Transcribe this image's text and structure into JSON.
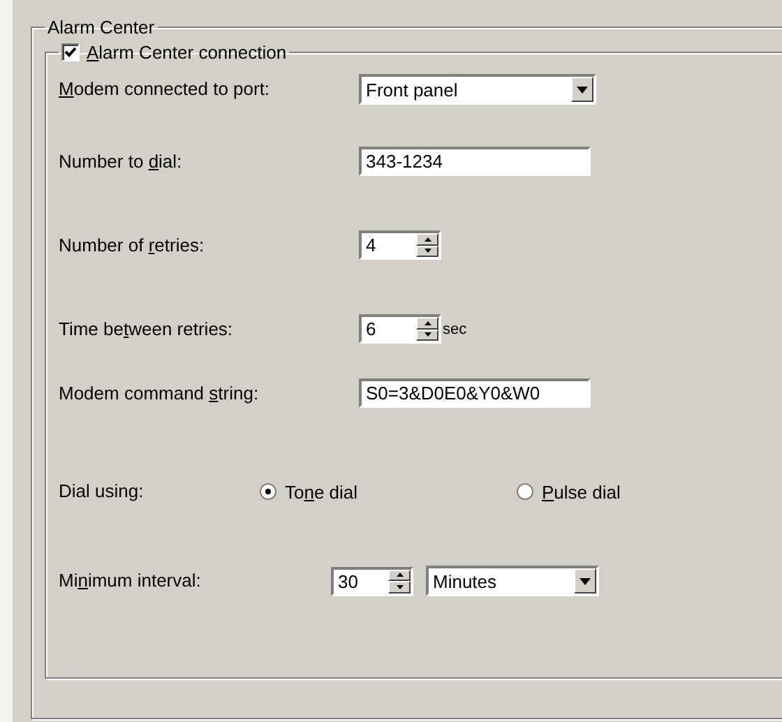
{
  "group": {
    "title": "Alarm Center"
  },
  "connection": {
    "label": {
      "key": "A",
      "post": "larm Center connection"
    },
    "checked": true
  },
  "rows": [
    {
      "kind": "combo",
      "label": {
        "key": "M",
        "post": "odem connected to port:"
      },
      "value": "Front panel"
    },
    {
      "kind": "text",
      "label": {
        "pre": "Number to ",
        "key": "d",
        "post": "ial:"
      },
      "value": "343-1234"
    },
    {
      "kind": "spin",
      "label": {
        "pre": "Number of ",
        "key": "r",
        "post": "etries:"
      },
      "value": "4"
    },
    {
      "kind": "spin",
      "label": {
        "pre": "Time be",
        "key": "t",
        "post": "ween retries:"
      },
      "value": "6",
      "unit": "sec"
    },
    {
      "kind": "text",
      "label": {
        "pre": "Modem command ",
        "key": "s",
        "post": "tring:"
      },
      "value": "S0=3&D0E0&Y0&W0"
    },
    {
      "kind": "radios",
      "label": {
        "pre": "Dial using:"
      },
      "options": [
        {
          "label": {
            "pre": "To",
            "key": "n",
            "post": "e dial"
          },
          "selected": true
        },
        {
          "label": {
            "key": "P",
            "post": "ulse dial"
          },
          "selected": false
        }
      ]
    },
    {
      "kind": "spincombo",
      "label": {
        "pre": "Mi",
        "key": "n",
        "post": "imum interval:"
      },
      "value": "30",
      "unit_value": "Minutes"
    }
  ]
}
